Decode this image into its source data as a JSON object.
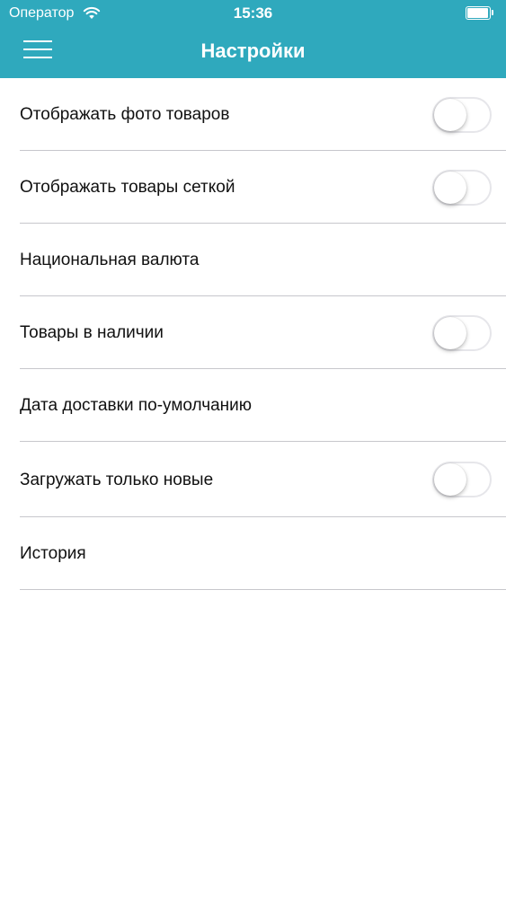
{
  "status_bar": {
    "carrier": "Оператор",
    "time": "15:36",
    "icons": [
      "wifi-icon",
      "battery-icon"
    ]
  },
  "nav": {
    "title": "Настройки",
    "menu_icon": "hamburger-menu-icon"
  },
  "colors": {
    "accent": "#2fa9bd",
    "divider": "#c7c7cc",
    "text": "#111111"
  },
  "settings": {
    "items": [
      {
        "label": "Отображать фото товаров",
        "has_toggle": true,
        "toggle_on": false
      },
      {
        "label": "Отображать товары сеткой",
        "has_toggle": true,
        "toggle_on": false
      },
      {
        "label": "Национальная валюта",
        "has_toggle": false
      },
      {
        "label": "Товары в наличии",
        "has_toggle": true,
        "toggle_on": false
      },
      {
        "label": "Дата доставки по-умолчанию",
        "has_toggle": false
      },
      {
        "label": "Загружать только новые",
        "has_toggle": true,
        "toggle_on": false
      },
      {
        "label": "История",
        "has_toggle": false
      }
    ]
  }
}
